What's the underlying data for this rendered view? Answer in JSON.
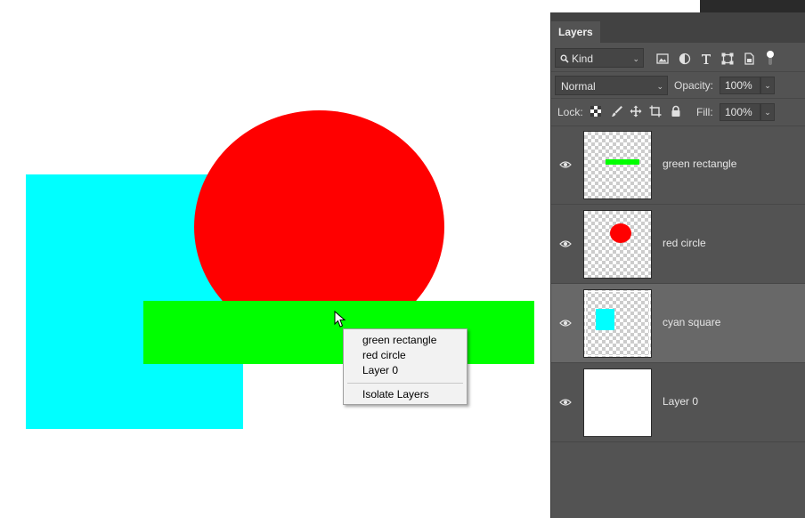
{
  "canvas": {
    "shape_colors": {
      "cyan": "#00ffff",
      "red": "#ff0000",
      "green": "#00ff00"
    },
    "context_menu": {
      "items": [
        "green rectangle",
        "red circle",
        "Layer 0"
      ],
      "isolate_label": "Isolate Layers"
    }
  },
  "layers_panel": {
    "tab_title": "Layers",
    "filter": {
      "kind_label": "Kind",
      "icons": [
        "pixel-filter-icon",
        "adjustment-filter-icon",
        "type-filter-icon",
        "shape-filter-icon",
        "smart-object-filter-icon",
        "filter-toggle-icon"
      ]
    },
    "blend_mode": "Normal",
    "opacity_label": "Opacity:",
    "opacity_value": "100%",
    "lock_label": "Lock:",
    "lock_icons": [
      "lock-transparent-icon",
      "lock-image-icon",
      "lock-position-icon",
      "lock-artboard-icon",
      "lock-all-icon"
    ],
    "fill_label": "Fill:",
    "fill_value": "100%",
    "layers": [
      {
        "name": "green rectangle",
        "visible": true,
        "selected": false
      },
      {
        "name": "red circle",
        "visible": true,
        "selected": false
      },
      {
        "name": "cyan square",
        "visible": true,
        "selected": true
      },
      {
        "name": "Layer 0",
        "visible": true,
        "selected": false
      }
    ]
  }
}
